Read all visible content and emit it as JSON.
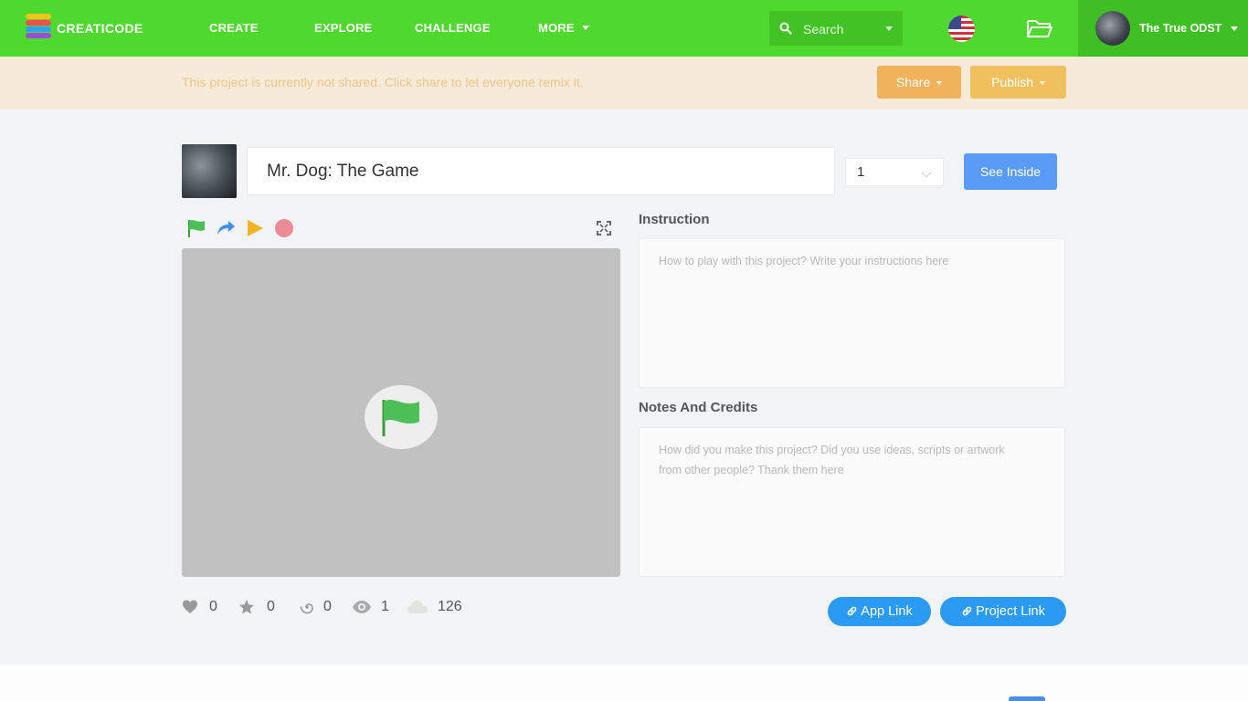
{
  "nav": {
    "logo_text": "CREATICODE",
    "links": [
      "CREATE",
      "EXPLORE",
      "CHALLENGE",
      "MORE"
    ],
    "search_placeholder": "Search",
    "user_name": "The True ODST"
  },
  "notice": {
    "text": "This project is currently not shared. Click share to let everyone remix it.",
    "share_label": "Share",
    "publish_label": "Publish"
  },
  "project": {
    "title": "Mr. Dog: The Game",
    "version": "1",
    "see_inside_label": "See Inside"
  },
  "panels": {
    "instruction_label": "Instruction",
    "instruction_placeholder": "How to play with this project? Write your instructions here",
    "notes_label": "Notes And Credits",
    "notes_placeholder": "How did you make this project? Did you use ideas, scripts or artwork from other people? Thank them here"
  },
  "stats": {
    "likes": "0",
    "favorites": "0",
    "remixes": "0",
    "views": "1",
    "size": "126"
  },
  "links": {
    "app_link_label": "App Link",
    "project_link_label": "Project Link"
  },
  "colors": {
    "nav_green": "#4fd82e",
    "accent_blue": "#2a9af2",
    "share_orange": "#f0b25a"
  }
}
